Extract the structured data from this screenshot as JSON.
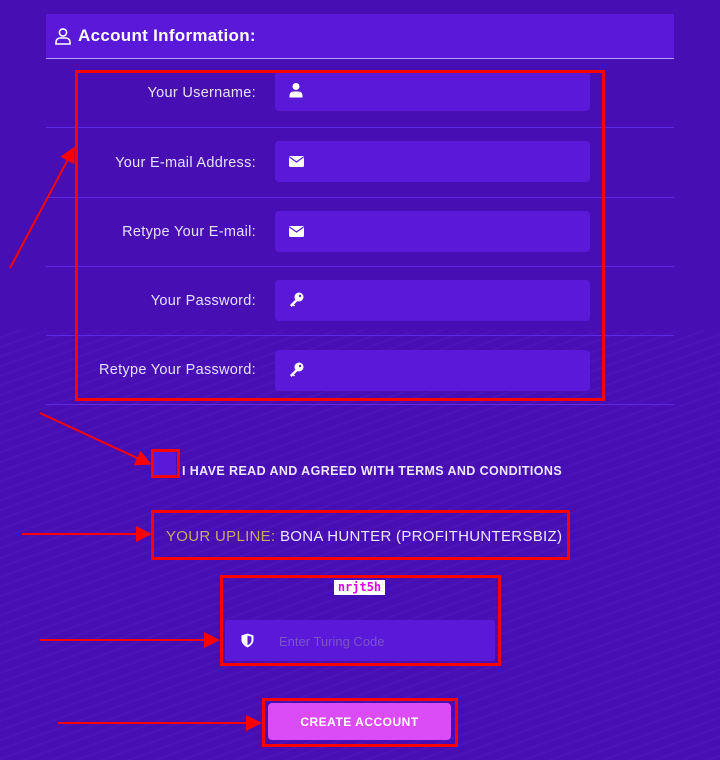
{
  "header": {
    "icon": "user-outline-icon",
    "title": "Account Information:"
  },
  "fields": [
    {
      "label": "Your Username:",
      "icon": "user-icon",
      "value": ""
    },
    {
      "label": "Your E-mail Address:",
      "icon": "envelope-icon",
      "value": ""
    },
    {
      "label": "Retype Your E-mail:",
      "icon": "envelope-icon",
      "value": ""
    },
    {
      "label": "Your Password:",
      "icon": "key-icon",
      "value": ""
    },
    {
      "label": "Retype Your Password:",
      "icon": "key-icon",
      "value": ""
    }
  ],
  "terms": {
    "checked": false,
    "label": "I HAVE READ AND AGREED WITH TERMS AND CONDITIONS"
  },
  "upline": {
    "label": "YOUR UPLINE:",
    "value": "BONA HUNTER (PROFITHUNTERSBIZ)"
  },
  "captcha": {
    "code": "nrjt5h",
    "icon": "shield-icon",
    "placeholder": "Enter Turing Code",
    "value": ""
  },
  "submit": {
    "label": "CREATE ACCOUNT"
  },
  "colors": {
    "background": "#470fb3",
    "field": "#5a18d8",
    "button": "#db4cf6",
    "annotation": "#ff0000",
    "upline_label": "#c8a96a"
  }
}
